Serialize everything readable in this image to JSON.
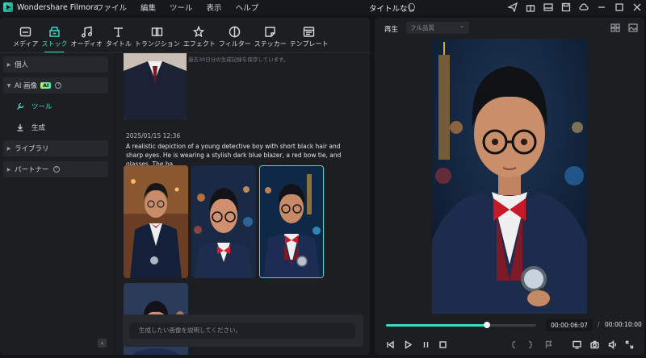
{
  "app": {
    "name": "Wondershare Filmora",
    "document_title": "タイトルなし"
  },
  "menu": [
    "ファイル",
    "編集",
    "ツール",
    "表示",
    "ヘルプ"
  ],
  "titlebar_icons": [
    "send-icon",
    "gift-icon",
    "layout-icon",
    "save-icon",
    "cloud-icon",
    "minimize-icon",
    "maximize-icon",
    "close-icon"
  ],
  "toolbar": [
    {
      "label": "メディア",
      "icon": "media-icon",
      "active": false
    },
    {
      "label": "ストック",
      "icon": "stock-icon",
      "active": true
    },
    {
      "label": "オーディオ",
      "icon": "audio-icon",
      "active": false
    },
    {
      "label": "タイトル",
      "icon": "title-icon",
      "active": false
    },
    {
      "label": "トランジション",
      "icon": "transition-icon",
      "active": false
    },
    {
      "label": "エフェクト",
      "icon": "effect-icon",
      "active": false
    },
    {
      "label": "フィルター",
      "icon": "filter-icon",
      "active": false
    },
    {
      "label": "ステッカー",
      "icon": "sticker-icon",
      "active": false
    },
    {
      "label": "テンプレート",
      "icon": "template-icon",
      "active": false
    }
  ],
  "sidebar": {
    "personal": "個人",
    "ai_image": "AI 画像",
    "ai_badge": "AI",
    "tools": "ツール",
    "generate": "生成",
    "library": "ライブラリ",
    "partner": "パートナー"
  },
  "content": {
    "top_note": "過去30日分の生成記録を保存しています。",
    "date": "2025/01/15 12:36",
    "prompt": "A realistic depiction of a young detective boy with short black hair and sharp eyes. He is wearing a stylish dark blue blazer, a red bow tie, and glasses. The ba...",
    "input_placeholder": "生成したい画像を説明してください。",
    "collapse": "‹"
  },
  "player": {
    "play_label": "再生",
    "quality": "フル品質",
    "current_time": "00:00:06:07",
    "separator": "/",
    "total_time": "00:00:10:00",
    "progress": 0.67
  },
  "colors": {
    "accent": "#36e0c4",
    "panel": "#1c1e22",
    "background": "#121417"
  }
}
